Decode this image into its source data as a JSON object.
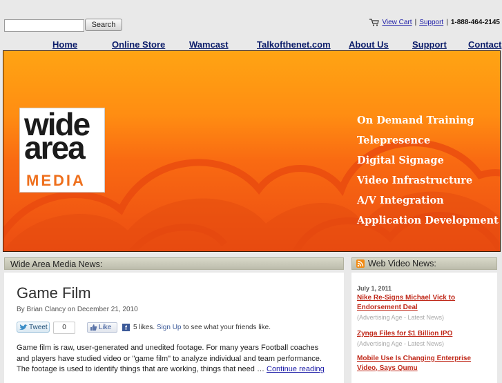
{
  "search": {
    "placeholder": "",
    "button_label": "Search"
  },
  "utility": {
    "cart_label": "View Cart",
    "support_label": "Support",
    "separator": "|",
    "phone": "1-888-464-2145"
  },
  "nav": [
    {
      "label": "Home"
    },
    {
      "label": "Online Store"
    },
    {
      "label": "Wamcast"
    },
    {
      "label": "Talkofthenet.com"
    },
    {
      "label": "About Us"
    },
    {
      "label": "Support"
    },
    {
      "label": "Contact"
    }
  ],
  "banner": {
    "logo": {
      "line1": "wide",
      "line2": "area",
      "line3": "MEDIA"
    },
    "services": [
      "On Demand Training",
      "Telepresence",
      "Digital Signage",
      "Video Infrastructure",
      "A/V Integration",
      "Application Development"
    ]
  },
  "news": {
    "header": "Wide Area Media News:",
    "post_title": "Game Film",
    "byline": "By Brian Clancy on December 21, 2010",
    "tweet_label": "Tweet",
    "tweet_count": "0",
    "like_label": "Like",
    "likes_text": "5 likes.",
    "signup_label": "Sign Up",
    "likes_suffix": "to see what your friends like.",
    "body": "Game film is raw, user-generated and unedited footage.  For many years Football coaches and players have studied video or \"game film\" to analyze individual and team performance.  The footage is used to identify things that are working, things that need … ",
    "continue_label": "Continue reading"
  },
  "web_video": {
    "header": "Web Video News:",
    "date": "July 1, 2011",
    "items": [
      {
        "title": "Nike Re-Signs Michael Vick to Endorsement Deal",
        "source": "(Advertising Age - Latest News)"
      },
      {
        "title": "Zynga Files for $1 Billion IPO",
        "source": "(Advertising Age - Latest News)"
      },
      {
        "title": "Mobile Use Is Changing Enterprise Video, Says Qumu",
        "source": ""
      }
    ]
  },
  "colors": {
    "accent": "#c0291a",
    "nav": "#0c1d6a",
    "banner_orange": "#f96a12"
  }
}
